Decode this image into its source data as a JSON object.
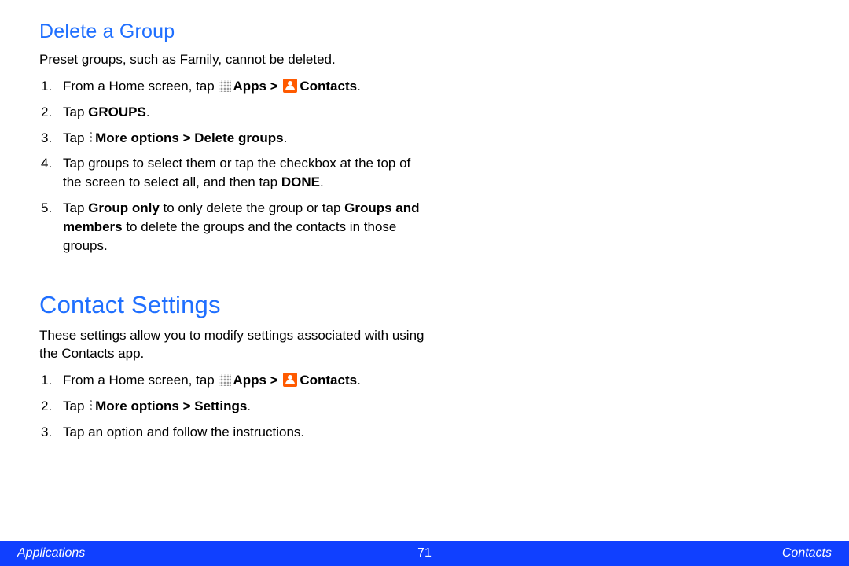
{
  "section1": {
    "heading": "Delete a Group",
    "intro": "Preset groups, such as Family, cannot be deleted.",
    "step1_prefix": "From a Home screen, tap ",
    "apps_bold": "Apps > ",
    "contacts_bold": "Contacts",
    "period": ".",
    "step2_prefix": "Tap ",
    "step2_bold": "GROUPS",
    "step3_prefix": "Tap ",
    "step3_bold": "More options > Delete groups",
    "step4_a": "Tap groups to select them or tap the checkbox at the top of the screen to select all, and then tap ",
    "step4_bold": "DONE",
    "step5_a": "Tap ",
    "step5_bold1": "Group only",
    "step5_b": " to only delete the group or tap ",
    "step5_bold2": "Groups and members",
    "step5_c": " to delete the groups and the contacts in those groups."
  },
  "section2": {
    "heading": "Contact Settings",
    "intro": "These settings allow you to modify settings associated with using the Contacts app.",
    "step1_prefix": "From a Home screen, tap ",
    "apps_bold": "Apps > ",
    "contacts_bold": "Contacts",
    "period": ".",
    "step2_prefix": "Tap ",
    "step2_bold": "More options > Settings",
    "step3": "Tap an option and follow the instructions."
  },
  "footer": {
    "left": "Applications",
    "center": "71",
    "right": "Contacts"
  }
}
